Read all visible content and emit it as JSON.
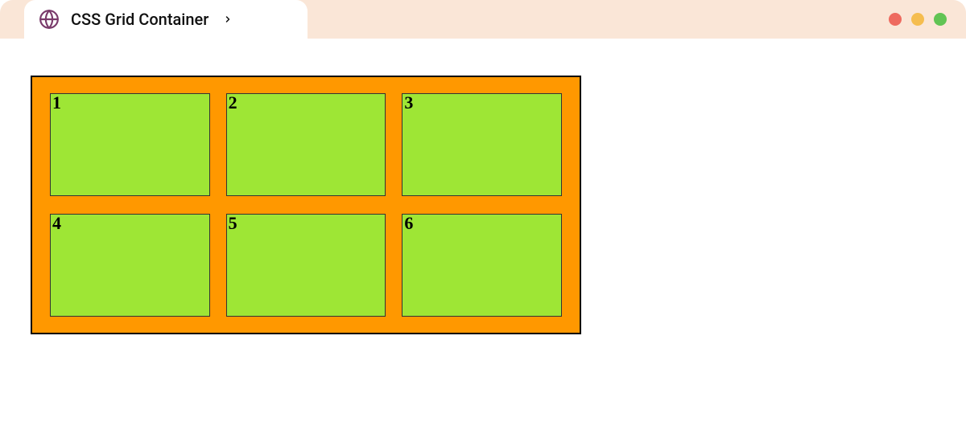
{
  "tab": {
    "title": "CSS Grid Container"
  },
  "grid": {
    "cells": [
      "1",
      "2",
      "3",
      "4",
      "5",
      "6"
    ]
  },
  "colors": {
    "tabbar_bg": "#fae6d7",
    "container_bg": "#ff9800",
    "cell_bg": "#9ee635"
  }
}
